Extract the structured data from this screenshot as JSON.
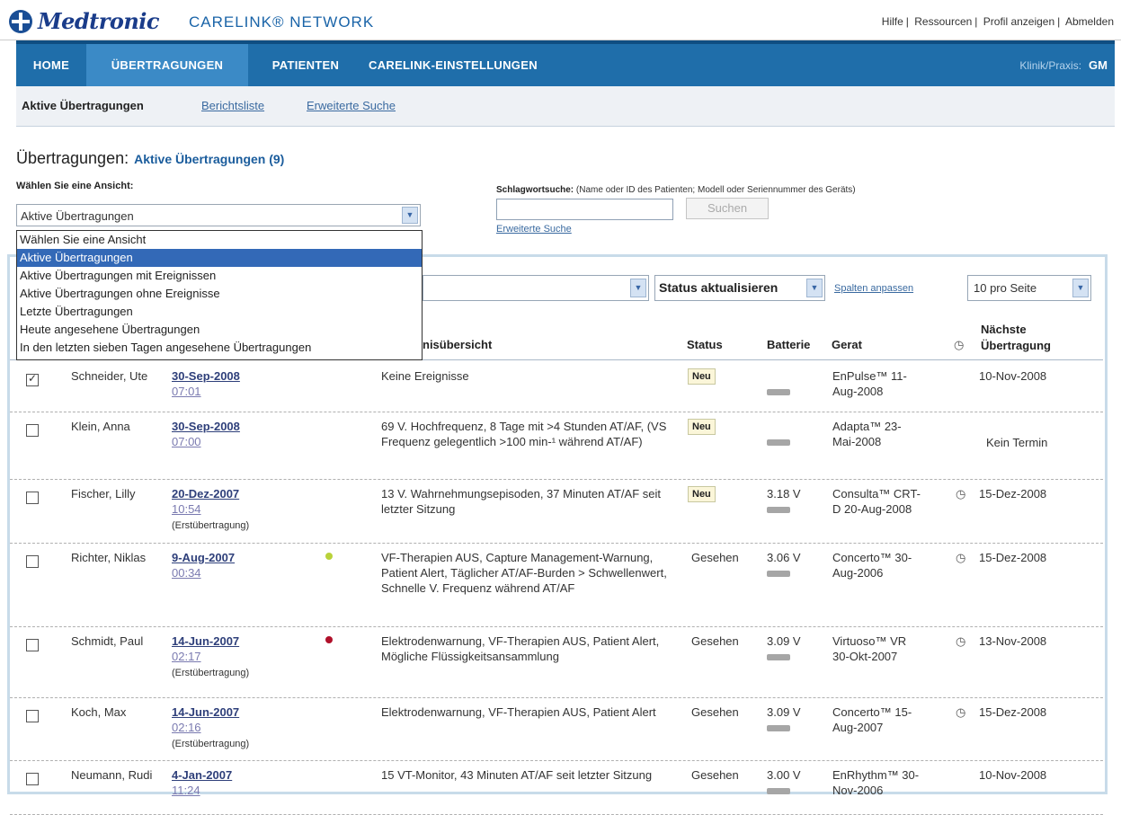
{
  "brand": {
    "logo": "Medtronic",
    "app": "CARELINK® NETWORK"
  },
  "top_links": [
    "Hilfe",
    "Ressourcen",
    "Profil anzeigen",
    "Abmelden"
  ],
  "nav": {
    "home": "HOME",
    "transmissions": "ÜBERTRAGUNGEN",
    "patients": "PATIENTEN",
    "settings": "CARELINK-EINSTELLUNGEN",
    "clinic_label": "Klinik/Praxis:",
    "clinic_code": "GM"
  },
  "subnav": {
    "active": "Aktive Übertragungen",
    "reports": "Berichtsliste",
    "advanced": "Erweiterte Suche"
  },
  "page": {
    "title": "Übertragungen:",
    "subtitle": "Aktive Übertragungen (9)",
    "view_label": "Wählen Sie eine Ansicht:"
  },
  "view_select": {
    "value": "Aktive Übertragungen",
    "options": [
      "Wählen Sie eine Ansicht",
      "Aktive Übertragungen",
      "Aktive Übertragungen mit Ereignissen",
      "Aktive Übertragungen ohne Ereignisse",
      "Letzte Übertragungen",
      "Heute angesehene Übertragungen",
      "In den letzten sieben Tagen angesehene Übertragungen"
    ],
    "selected_index": 1
  },
  "keyword": {
    "label": "Schlagwortsuche:",
    "hint": "(Name oder ID des Patienten; Modell oder Seriennummer des Geräts)",
    "button": "Suchen",
    "advanced": "Erweiterte Suche"
  },
  "toolbar": {
    "status_action": "Status aktualisieren",
    "columns_link": "Spalten anpassen",
    "per_page": "10 pro Seite"
  },
  "columns": {
    "summary": "nisübersicht",
    "status": "Status",
    "battery": "Batterie",
    "device": "Gerat",
    "next_line1": "Nächste",
    "next_line2": "Übertragung"
  },
  "rows": [
    {
      "checked": true,
      "name": "Schneider, Ute",
      "date": "30-Sep-2008",
      "time": "07:01",
      "first": "",
      "dot": "",
      "summary": "Keine Ereignisse",
      "status": "Neu",
      "status_badge": true,
      "battery": "",
      "device": "EnPulse™ 11-Aug-2008",
      "icon": false,
      "next": "10-Nov-2008"
    },
    {
      "checked": false,
      "name": "Klein, Anna",
      "date": "30-Sep-2008",
      "time": "07:00",
      "first": "",
      "dot": "",
      "summary": "69 V. Hochfrequenz, 8 Tage mit >4 Stunden AT/AF, (VS Frequenz gelegentlich >100 min-¹ während AT/AF)",
      "status": "Neu",
      "status_badge": true,
      "battery": "",
      "device": "Adapta™ 23-Mai-2008",
      "icon": false,
      "next": "Kein Termin"
    },
    {
      "checked": false,
      "name": "Fischer, Lilly",
      "date": "20-Dez-2007",
      "time": "10:54",
      "first": "(Erstübertragung)",
      "dot": "",
      "summary": "13 V. Wahrnehmungsepisoden, 37 Minuten AT/AF seit letzter Sitzung",
      "status": "Neu",
      "status_badge": true,
      "battery": "3.18 V",
      "device": "Consulta™ CRT-D 20-Aug-2008",
      "icon": true,
      "next": "15-Dez-2008"
    },
    {
      "checked": false,
      "name": "Richter, Niklas",
      "date": "9-Aug-2007",
      "time": "00:34",
      "first": "",
      "dot": "#b9d23a",
      "summary": "VF-Therapien AUS, Capture Management-Warnung, Patient Alert, Täglicher AT/AF-Burden > Schwellenwert, Schnelle V. Frequenz während AT/AF",
      "status": "Gesehen",
      "status_badge": false,
      "battery": "3.06 V",
      "device": "Concerto™ 30-Aug-2006",
      "icon": true,
      "next": "15-Dez-2008"
    },
    {
      "checked": false,
      "name": "Schmidt, Paul",
      "date": "14-Jun-2007",
      "time": "02:17",
      "first": "(Erstübertragung)",
      "dot": "#b0102a",
      "summary": "Elektrodenwarnung, VF-Therapien AUS, Patient Alert, Mögliche Flüssigkeitsansammlung",
      "status": "Gesehen",
      "status_badge": false,
      "battery": "3.09 V",
      "device": "Virtuoso™ VR 30-Okt-2007",
      "icon": true,
      "next": "13-Nov-2008"
    },
    {
      "checked": false,
      "name": "Koch, Max",
      "date": "14-Jun-2007",
      "time": "02:16",
      "first": "(Erstübertragung)",
      "dot": "",
      "summary": "Elektrodenwarnung, VF-Therapien AUS, Patient Alert",
      "status": "Gesehen",
      "status_badge": false,
      "battery": "3.09 V",
      "device": "Concerto™ 15-Aug-2007",
      "icon": true,
      "next": "15-Dez-2008"
    },
    {
      "checked": false,
      "name": "Neumann, Rudi",
      "date": "4-Jan-2007",
      "time": "11:24",
      "first": "",
      "dot": "",
      "summary": "15 VT-Monitor, 43 Minuten AT/AF seit letzter Sitzung",
      "status": "Gesehen",
      "status_badge": false,
      "battery": "3.00 V",
      "device": "EnRhythm™ 30-Nov-2006",
      "icon": false,
      "next": "10-Nov-2008"
    }
  ]
}
